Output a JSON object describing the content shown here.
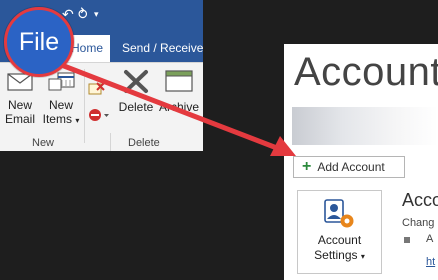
{
  "ribbon": {
    "file_label": "File",
    "tabs": [
      {
        "label": "Home",
        "active": true
      },
      {
        "label": "Send / Receive",
        "active": false
      }
    ],
    "buttons": {
      "new_email": [
        "New",
        "Email"
      ],
      "new_items": [
        "New",
        "Items"
      ],
      "delete": "Delete",
      "archive": "Archive"
    },
    "groups": {
      "new": "New",
      "delete": "Delete"
    }
  },
  "account": {
    "heading": "Account",
    "add_account_label": "Add Account",
    "settings_button": [
      "Account",
      "Settings"
    ],
    "section_heading": "Acco",
    "section_sub": "Chang",
    "bullet_text": "A",
    "link_text": "ht"
  },
  "colors": {
    "brand_blue": "#2b579a",
    "file_circle": "#2b63c5",
    "arrow_red": "#e43a3f",
    "add_plus": "#2c8a3d",
    "settings_orange": "#e8861c"
  },
  "icons": [
    "save-icon",
    "undo-icon",
    "qat-dropdown-icon",
    "new-email-icon",
    "new-items-icon",
    "ignore-icon",
    "cleanup-icon",
    "delete-icon",
    "archive-icon",
    "add-icon",
    "account-settings-icon",
    "arrow-annotation"
  ]
}
